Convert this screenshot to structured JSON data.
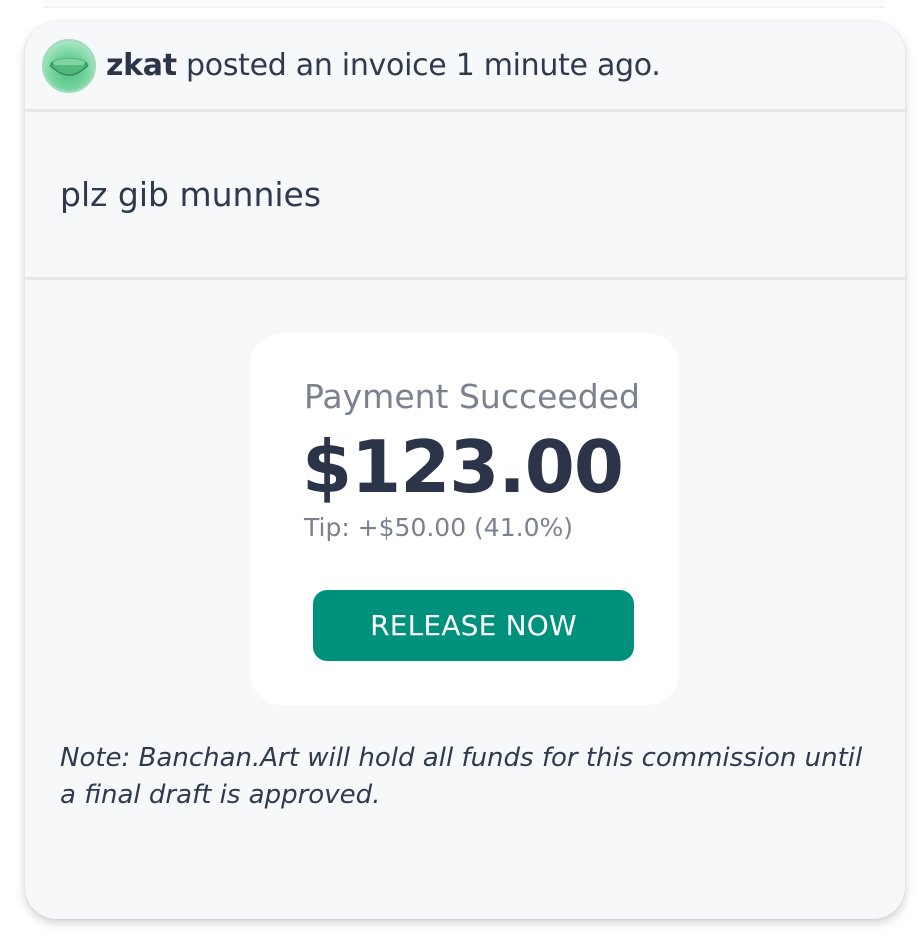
{
  "post": {
    "username": "zkat",
    "action_text": " posted an invoice 1 minute ago.",
    "message": "plz gib munnies"
  },
  "payment": {
    "status": "Payment Succeeded",
    "amount": "$123.00",
    "tip": "Tip: +$50.00 (41.0%)",
    "release_label": "RELEASE NOW"
  },
  "note": "Note: Banchan.Art will hold all funds for this commission until a final draft is approved.",
  "colors": {
    "accent": "#00917c",
    "card_bg": "#f7f8fa",
    "text": "#2d3748",
    "muted": "#7b8190"
  }
}
